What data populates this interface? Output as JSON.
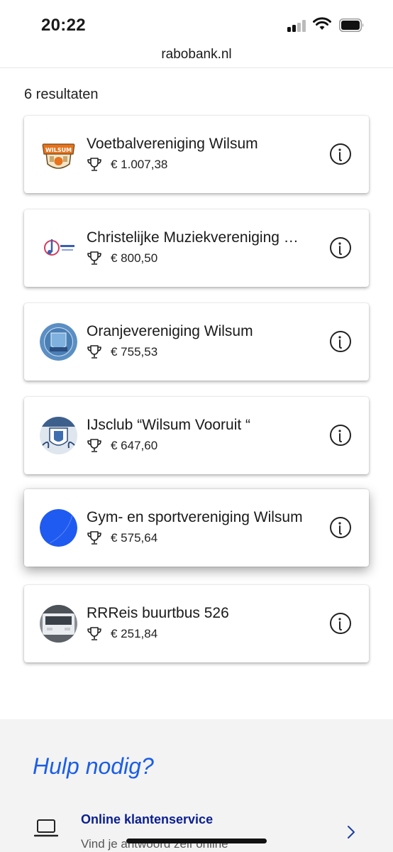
{
  "status_bar": {
    "time": "20:22"
  },
  "browser": {
    "url": "rabobank.nl"
  },
  "results": {
    "count_label": "6 resultaten",
    "items": [
      {
        "name": "Voetbalvereniging Wilsum",
        "amount": "€ 1.007,38",
        "logo": "football-club-crest"
      },
      {
        "name": "Christelijke Muziekvereniging …",
        "amount": "€ 800,50",
        "logo": "music-note-logo"
      },
      {
        "name": "Oranjevereniging Wilsum",
        "amount": "€ 755,53",
        "logo": "blue-seal-logo"
      },
      {
        "name": "IJsclub “Wilsum Vooruit “",
        "amount": "€ 647,60",
        "logo": "ice-club-crest"
      },
      {
        "name": "Gym- en sportvereniging Wilsum",
        "amount": "€ 575,64",
        "logo": "blue-circle-logo"
      },
      {
        "name": "RRReis buurtbus 526",
        "amount": "€ 251,84",
        "logo": "bus-photo"
      }
    ]
  },
  "help": {
    "title": "Hulp nodig?",
    "link_label": "Online klantenservice",
    "link_sub": "Vind je antwoord zelf online"
  },
  "colors": {
    "accent": "#1b5ee6",
    "link": "#0a1f8f",
    "help_bg": "#f3f3f3"
  }
}
